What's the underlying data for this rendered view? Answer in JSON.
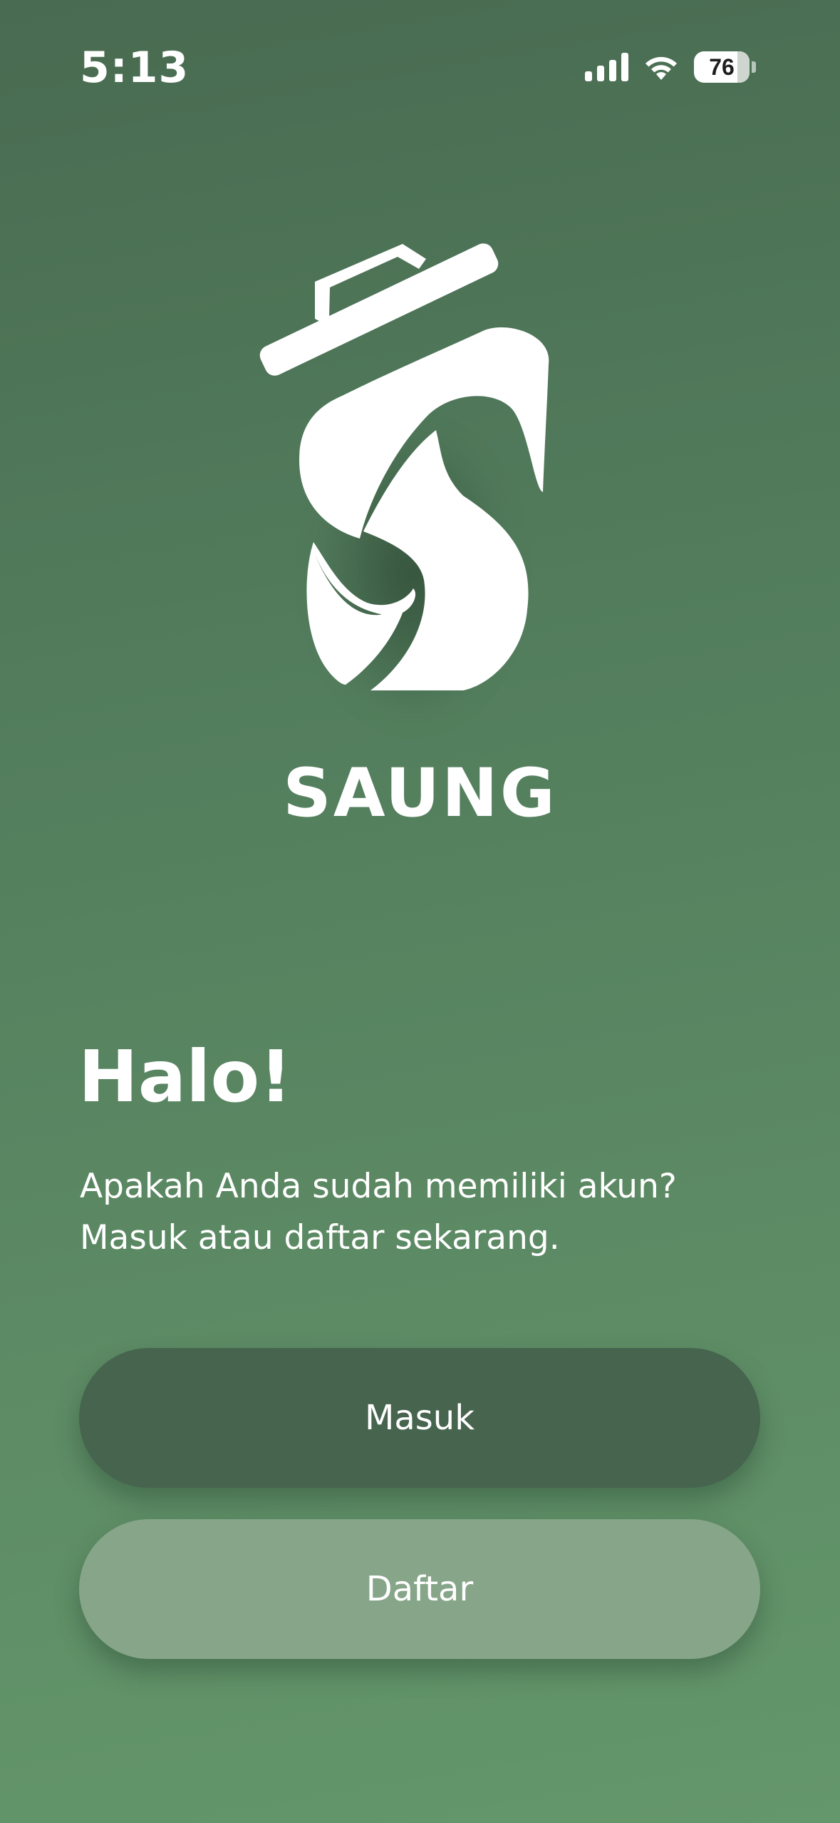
{
  "status_bar": {
    "time": "5:13",
    "battery": "76",
    "icons": [
      "signal-icon",
      "wifi-icon",
      "battery-icon"
    ]
  },
  "brand": {
    "name": "SAUNG",
    "logo": "trash-bin-s-logo"
  },
  "welcome": {
    "title": "Halo!",
    "line1": "Apakah Anda sudah memiliki akun?",
    "line2": "Masuk atau daftar sekarang."
  },
  "actions": {
    "login_label": "Masuk",
    "register_label": "Daftar"
  },
  "colors": {
    "background_top": "#496b51",
    "background_bottom": "#64976b",
    "login_button": "#46644e",
    "register_button": "#86a589",
    "text": "#ffffff"
  }
}
